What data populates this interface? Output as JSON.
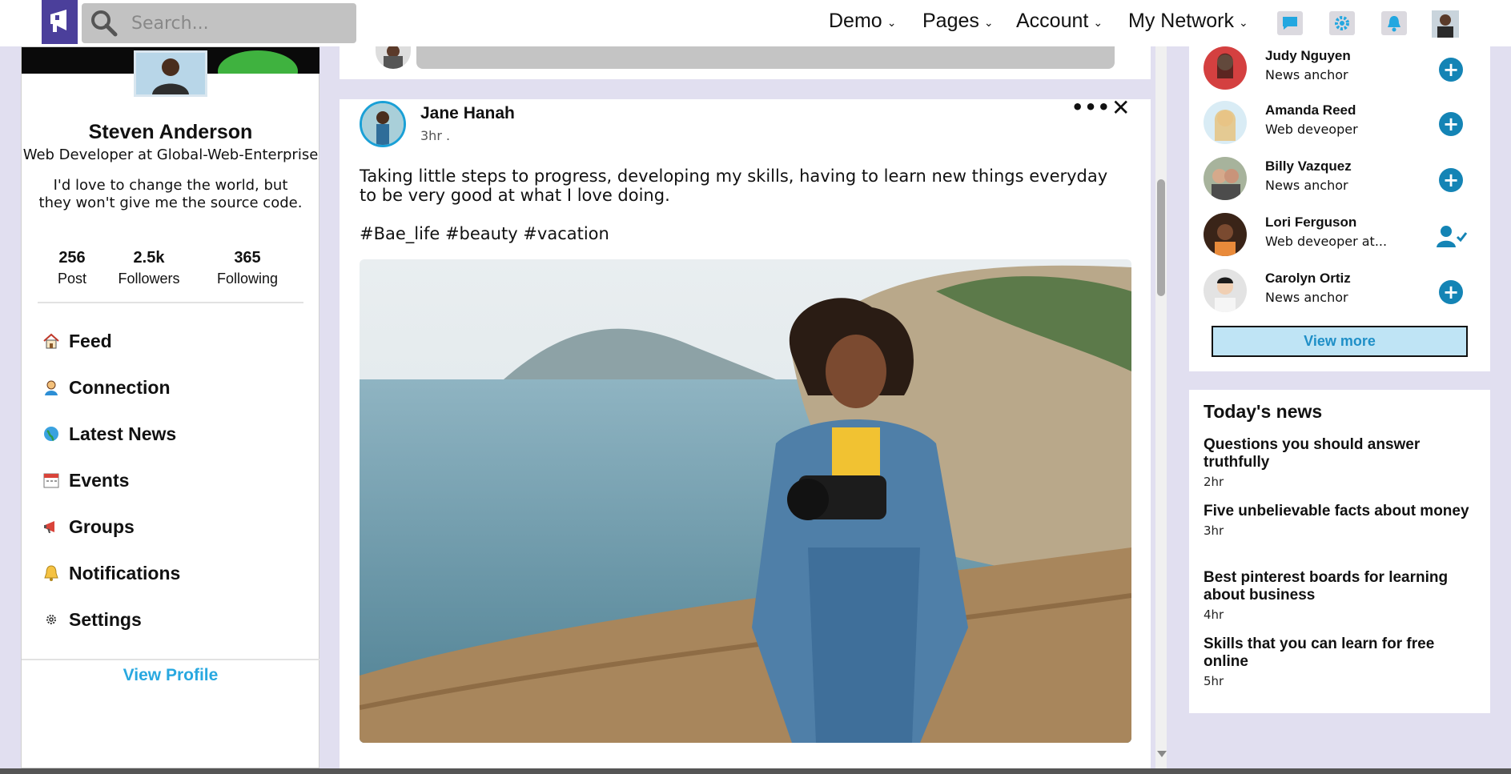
{
  "nav": {
    "search_placeholder": "Search...",
    "menus": [
      "Demo",
      "Pages",
      "Account",
      "My Network"
    ]
  },
  "profile": {
    "name": "Steven Anderson",
    "role": "Web Developer at Global-Web-Enterprise",
    "quote": "I'd love to change the world, but they won't give me the source code.",
    "stats": [
      {
        "num": "256",
        "label": "Post"
      },
      {
        "num": "2.5k",
        "label": "Followers"
      },
      {
        "num": "365",
        "label": "Following"
      }
    ],
    "menu": [
      {
        "label": "Feed",
        "icon": "home-icon"
      },
      {
        "label": "Connection",
        "icon": "person-icon"
      },
      {
        "label": "Latest News",
        "icon": "globe-icon"
      },
      {
        "label": "Events",
        "icon": "calendar-icon"
      },
      {
        "label": "Groups",
        "icon": "megaphone-icon"
      },
      {
        "label": "Notifications",
        "icon": "bell-icon"
      },
      {
        "label": "Settings",
        "icon": "gear-icon"
      }
    ],
    "view_profile": "View Profile"
  },
  "post": {
    "author": "Jane Hanah",
    "time": "3hr .",
    "text": "Taking little steps to progress, developing my skills, having to learn new things everyday to be very good at what I love doing.",
    "tags": "#Bae_life #beauty #vacation"
  },
  "suggestions": {
    "people": [
      {
        "name": "Judy Nguyen",
        "role": "News anchor",
        "state": "add"
      },
      {
        "name": "Amanda Reed",
        "role": "Web deveoper",
        "state": "add"
      },
      {
        "name": "Billy Vazquez",
        "role": "News anchor",
        "state": "add"
      },
      {
        "name": "Lori Ferguson",
        "role": "Web deveoper at...",
        "state": "connected"
      },
      {
        "name": "Carolyn Ortiz",
        "role": "News anchor",
        "state": "add"
      }
    ],
    "view_more": "View more"
  },
  "news": {
    "title": "Today's news",
    "items": [
      {
        "headline": "Questions you should answer truthfully",
        "time": "2hr"
      },
      {
        "headline": "Five unbelievable facts about money",
        "time": "3hr"
      },
      {
        "headline": "Best pinterest boards for learning about business",
        "time": "4hr"
      },
      {
        "headline": "Skills that you can learn for free online",
        "time": "5hr"
      }
    ]
  },
  "colors": {
    "brand": "#4b3f9b",
    "accent": "#28a8e0",
    "add_button": "#1484b5",
    "background": "#e1dff0"
  }
}
